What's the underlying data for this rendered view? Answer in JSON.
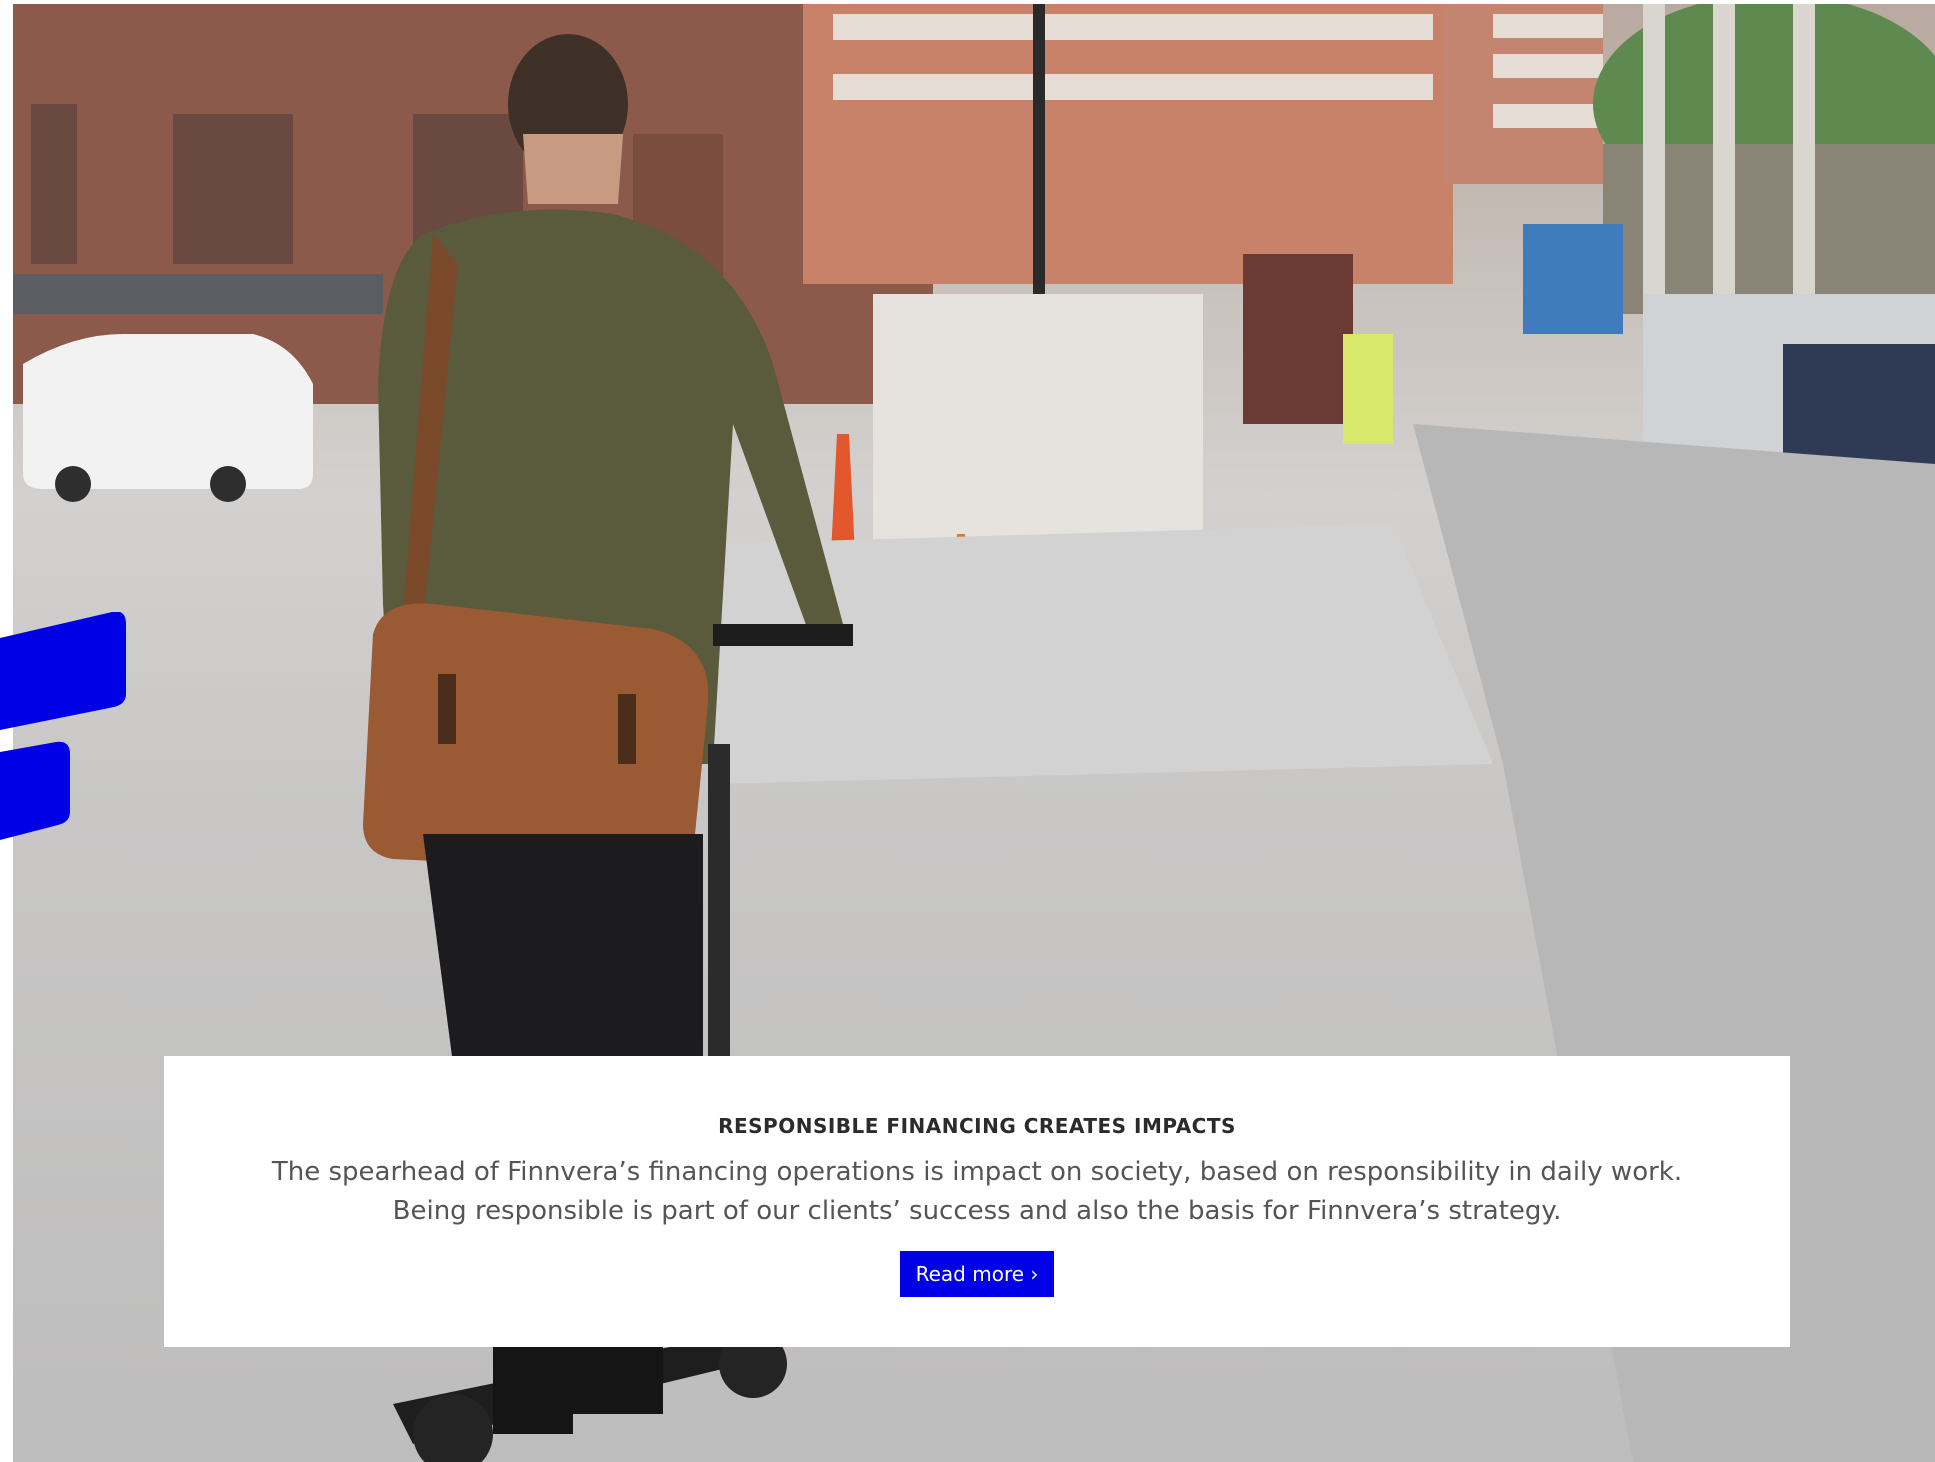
{
  "hero": {
    "image_alt": "Man with leather messenger bag riding an electric scooter on a city street"
  },
  "feature_card": {
    "title": "RESPONSIBLE FINANCING CREATES IMPACTS",
    "body_line_1": "The spearhead of Finnvera’s financing operations is impact on society, based on responsibility in daily work.",
    "body_line_2": "Being responsible is part of our clients’ success and also the basis for Finnvera’s strategy.",
    "button_label": "Read more ›"
  },
  "colors": {
    "brand_blue": "#0000e6",
    "card_background": "#ffffff",
    "title_text": "#2b2b2b",
    "body_text": "#555555"
  },
  "icons": {
    "brand_mark": "finnvera-f-logo-shape"
  }
}
